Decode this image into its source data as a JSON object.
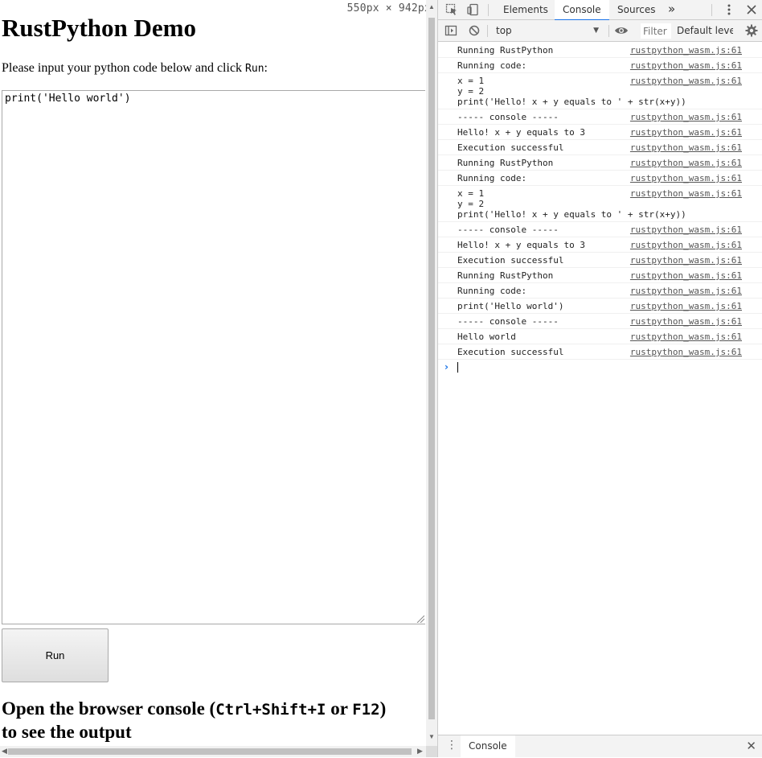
{
  "page": {
    "dimensions": "550px × 942px",
    "title": "RustPython Demo",
    "instructions_prefix": "Please input your python code below and click ",
    "instructions_code": "Run",
    "instructions_suffix": ":",
    "code_value": "print('Hello world')",
    "run_button_label": "Run",
    "output_note_prefix": "Open the browser console (",
    "output_note_key1": "Ctrl+Shift+I",
    "output_note_or": " or ",
    "output_note_key2": "F12",
    "output_note_suffix": ")",
    "output_note_line2": "to see the output"
  },
  "devtools": {
    "tabs": [
      "Elements",
      "Console",
      "Sources"
    ],
    "active_tab": "Console",
    "overflow_icon": "»",
    "context": "top",
    "filter_placeholder": "Filter",
    "levels": "Default levels",
    "messages": [
      {
        "text": "Running RustPython",
        "source": "rustpython_wasm.js:61"
      },
      {
        "text": "Running code:",
        "source": "rustpython_wasm.js:61"
      },
      {
        "text": "x = 1\ny = 2\nprint('Hello! x + y equals to ' + str(x+y))\n",
        "source": "rustpython_wasm.js:61"
      },
      {
        "text": "----- console -----",
        "source": "rustpython_wasm.js:61"
      },
      {
        "text": "Hello! x + y equals to 3",
        "source": "rustpython_wasm.js:61"
      },
      {
        "text": "Execution successful",
        "source": "rustpython_wasm.js:61"
      },
      {
        "text": "Running RustPython",
        "source": "rustpython_wasm.js:61"
      },
      {
        "text": "Running code:",
        "source": "rustpython_wasm.js:61"
      },
      {
        "text": "x = 1\ny = 2\nprint('Hello! x + y equals to ' + str(x+y))\n",
        "source": "rustpython_wasm.js:61"
      },
      {
        "text": "----- console -----",
        "source": "rustpython_wasm.js:61"
      },
      {
        "text": "Hello! x + y equals to 3",
        "source": "rustpython_wasm.js:61"
      },
      {
        "text": "Execution successful",
        "source": "rustpython_wasm.js:61"
      },
      {
        "text": "Running RustPython",
        "source": "rustpython_wasm.js:61"
      },
      {
        "text": "Running code:",
        "source": "rustpython_wasm.js:61"
      },
      {
        "text": "print('Hello world')\n",
        "source": "rustpython_wasm.js:61"
      },
      {
        "text": "----- console -----",
        "source": "rustpython_wasm.js:61"
      },
      {
        "text": "Hello world",
        "source": "rustpython_wasm.js:61"
      },
      {
        "text": "Execution successful",
        "source": "rustpython_wasm.js:61"
      }
    ],
    "prompt_symbol": "›",
    "drawer_tab": "Console",
    "icons": [
      "inspect-icon",
      "device-toolbar-icon",
      "kebab-menu-icon",
      "close-icon",
      "sidebar-toggle-icon",
      "clear-console-icon",
      "eye-icon",
      "settings-gear-icon",
      "drawer-menu-icon"
    ]
  },
  "colors": {
    "accent": "#1a73e8",
    "toolbar_bg": "#f3f3f3",
    "border": "#cccccc",
    "button_bg": "#e6e6e6"
  }
}
